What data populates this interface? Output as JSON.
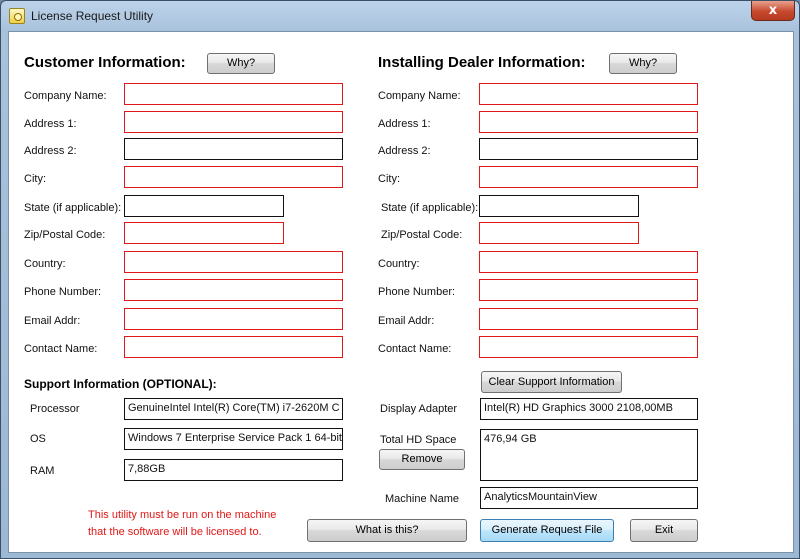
{
  "window": {
    "title": "License Request Utility",
    "close_glyph": "x"
  },
  "customer": {
    "heading": "Customer Information:",
    "why_label": "Why?",
    "fields": [
      {
        "label": "Company Name:",
        "value": ""
      },
      {
        "label": "Address 1:",
        "value": ""
      },
      {
        "label": "Address 2:",
        "value": ""
      },
      {
        "label": "City:",
        "value": ""
      },
      {
        "label": "State (if applicable):",
        "value": ""
      },
      {
        "label": "Zip/Postal Code:",
        "value": ""
      },
      {
        "label": "Country:",
        "value": ""
      },
      {
        "label": "Phone Number:",
        "value": ""
      },
      {
        "label": "Email Addr:",
        "value": ""
      },
      {
        "label": "Contact Name:",
        "value": ""
      }
    ]
  },
  "dealer": {
    "heading": "Installing Dealer Information:",
    "why_label": "Why?",
    "fields": [
      {
        "label": "Company Name:",
        "value": ""
      },
      {
        "label": "Address 1:",
        "value": ""
      },
      {
        "label": "Address 2:",
        "value": ""
      },
      {
        "label": "City:",
        "value": ""
      },
      {
        "label": "State (if applicable):",
        "value": ""
      },
      {
        "label": "Zip/Postal Code:",
        "value": ""
      },
      {
        "label": "Country:",
        "value": ""
      },
      {
        "label": "Phone Number:",
        "value": ""
      },
      {
        "label": "Email Addr:",
        "value": ""
      },
      {
        "label": "Contact Name:",
        "value": ""
      }
    ]
  },
  "support": {
    "heading": "Support Information (OPTIONAL):",
    "clear_label": "Clear Support Information",
    "processor_label": "Processor",
    "processor_value": "GenuineIntel  Intel(R) Core(TM) i7-2620M C",
    "os_label": "OS",
    "os_value": "Windows 7 Enterprise Service Pack 1 64-bit",
    "ram_label": "RAM",
    "ram_value": "7,88GB",
    "display_label": "Display Adapter",
    "display_value": "Intel(R) HD Graphics 3000   2108,00MB",
    "hd_label": "Total HD Space",
    "hd_value": "476,94 GB",
    "remove_label": "Remove",
    "machine_label": "Machine Name",
    "machine_value": "AnalyticsMountainView"
  },
  "footer": {
    "warning_line1": "This utility must be run on the machine",
    "warning_line2": "that the software will be licensed to.",
    "what_label": "What is this?",
    "generate_label": "Generate Request File",
    "exit_label": "Exit"
  }
}
